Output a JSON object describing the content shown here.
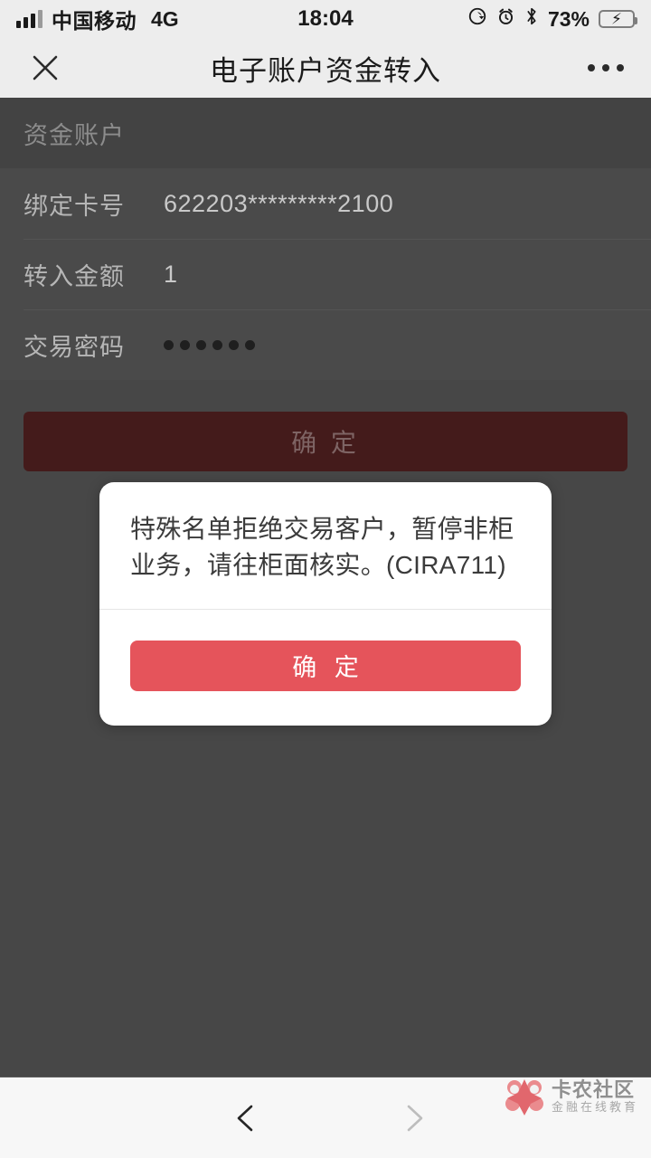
{
  "status_bar": {
    "carrier": "中国移动",
    "network": "4G",
    "time": "18:04",
    "battery_percent": "73%",
    "icons": [
      "signal-bars-icon",
      "rotation-lock-icon",
      "alarm-clock-icon",
      "bluetooth-icon",
      "battery-charging-icon"
    ]
  },
  "nav_bar": {
    "close_label": "close-icon",
    "title": "电子账户资金转入",
    "more_label": "more-options-icon"
  },
  "page": {
    "section_title": "资金账户",
    "rows": [
      {
        "label": "绑定卡号",
        "value": "622203*********2100"
      },
      {
        "label": "转入金额",
        "value": "1"
      },
      {
        "label": "交易密码",
        "value": "••••••",
        "masked": true,
        "mask_count": 6
      }
    ],
    "submit_label": "确 定"
  },
  "dialog": {
    "message": "特殊名单拒绝交易客户，暂停非柜业务，请往柜面核实。(CIRA711)",
    "confirm_label": "确 定",
    "button_color": "#e5545b"
  },
  "bottom_bar": {
    "back_label": "back-chevron-icon",
    "forward_label": "forward-chevron-icon",
    "forward_disabled": true
  },
  "watermark": {
    "title": "卡农社区",
    "subtitle": "金融在线教育",
    "color": "#e06a6a"
  },
  "colors": {
    "nav_background": "#ededed",
    "overlay_dim": "#474747",
    "submit_dimmed": "#441b1b",
    "dialog_accent": "#e5545b"
  }
}
